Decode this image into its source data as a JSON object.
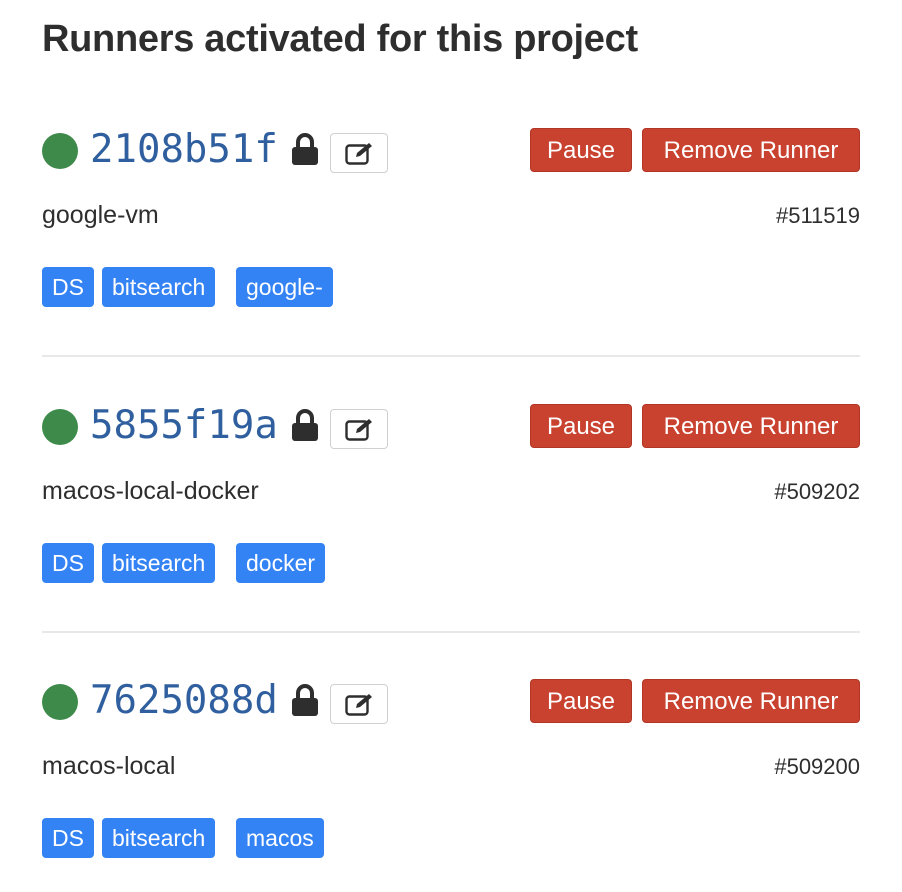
{
  "page": {
    "title": "Runners activated for this project"
  },
  "actions": {
    "pause_label": "Pause",
    "remove_label": "Remove Runner"
  },
  "colors": {
    "status_online": "#3d8a4a",
    "token_link": "#2f5f9e",
    "danger": "#c9412f",
    "tag": "#3483f5"
  },
  "runners": [
    {
      "token": "2108b51f",
      "description": "google-vm",
      "id": "#511519",
      "status": "online",
      "locked": true,
      "tags": [
        "DS",
        "bitsearch",
        "google-vm"
      ]
    },
    {
      "token": "5855f19a",
      "description": "macos-local-docker",
      "id": "#509202",
      "status": "online",
      "locked": true,
      "tags": [
        "DS",
        "bitsearch",
        "docker"
      ]
    },
    {
      "token": "7625088d",
      "description": "macos-local",
      "id": "#509200",
      "status": "online",
      "locked": true,
      "tags": [
        "DS",
        "bitsearch",
        "macos"
      ]
    }
  ]
}
